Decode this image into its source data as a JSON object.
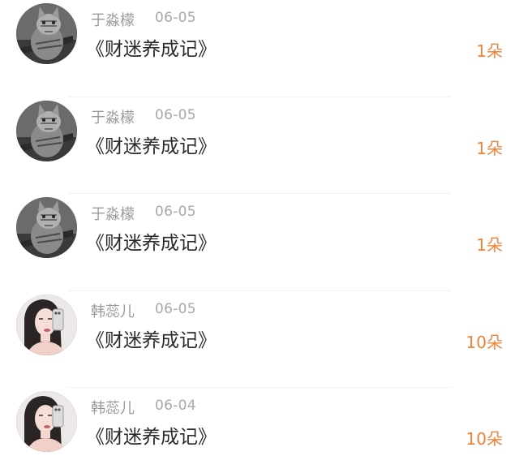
{
  "records": [
    {
      "avatar": "cat-avatar",
      "name": "于淼檬",
      "date": "06-05",
      "title": "《财迷养成记》",
      "count": "1朵"
    },
    {
      "avatar": "cat-avatar",
      "name": "于淼檬",
      "date": "06-05",
      "title": "《财迷养成记》",
      "count": "1朵"
    },
    {
      "avatar": "cat-avatar",
      "name": "于淼檬",
      "date": "06-05",
      "title": "《财迷养成记》",
      "count": "1朵"
    },
    {
      "avatar": "girl-avatar",
      "name": "韩蕊儿",
      "date": "06-05",
      "title": "《财迷养成记》",
      "count": "10朵"
    },
    {
      "avatar": "girl-avatar",
      "name": "韩蕊儿",
      "date": "06-04",
      "title": "《财迷养成记》",
      "count": "10朵"
    }
  ],
  "colors": {
    "accent": "#f0833a",
    "name": "#9a9a9a",
    "date": "#a8a8a8",
    "title": "#2a2a2a",
    "divider": "#f1f1f1"
  }
}
